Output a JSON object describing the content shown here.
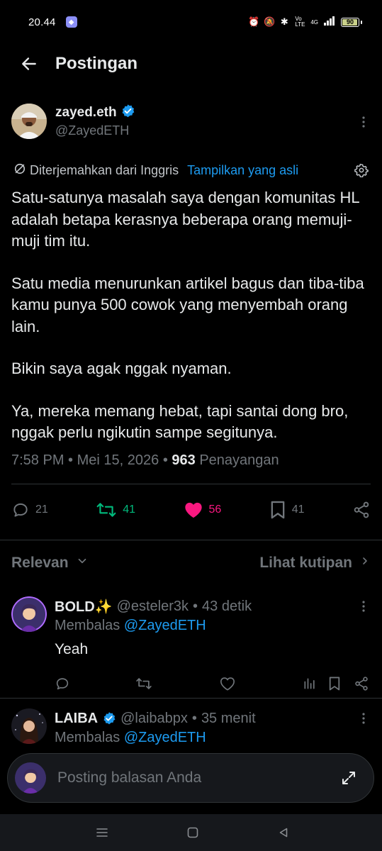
{
  "status_bar": {
    "time": "20.44",
    "app_icon": "messaging-app-icon",
    "network_label": "4G",
    "volte_label": "Vo LTE",
    "battery_level": "90"
  },
  "header": {
    "title": "Postingan",
    "back_icon": "arrow-left-icon"
  },
  "post": {
    "author": {
      "name": "zayed.eth",
      "handle": "@ZayedETH",
      "verified": true
    },
    "translation": {
      "label": "Diterjemahkan dari Inggris",
      "show_original": "Tampilkan yang asli"
    },
    "paragraphs": [
      "Satu-satunya masalah saya dengan komunitas HL adalah betapa kerasnya beberapa orang memuji-muji tim itu.",
      "Satu media menurunkan artikel bagus dan tiba-tiba kamu punya 500 cowok yang menyembah orang lain.",
      "Bikin saya agak nggak nyaman.",
      "Ya, mereka memang hebat, tapi santai dong bro, nggak perlu ngikutin sampe segitunya."
    ],
    "meta": {
      "time": "7:58 PM",
      "date": "Mei 15, 2026",
      "views": "963",
      "views_label": "Penayangan"
    },
    "stats": {
      "replies": "21",
      "reposts": "41",
      "likes": "56",
      "bookmarks": "41"
    },
    "colors": {
      "repost": "#00ba7c",
      "like": "#f91880",
      "link": "#1d9bf0"
    }
  },
  "sort": {
    "left": "Relevan",
    "right": "Lihat kutipan"
  },
  "replies": [
    {
      "name": "BOLD✨",
      "handle": "@esteler3k",
      "time": "43 detik",
      "replying_prefix": "Membalas",
      "replying_to": "@ZayedETH",
      "text": "Yeah"
    },
    {
      "name": "LAIBA",
      "handle": "@laibabpx",
      "time": "35 menit",
      "replying_prefix": "Membalas",
      "replying_to": "@ZayedETH",
      "verified": true
    }
  ],
  "compose": {
    "placeholder": "Posting balasan Anda"
  },
  "separator": "•"
}
